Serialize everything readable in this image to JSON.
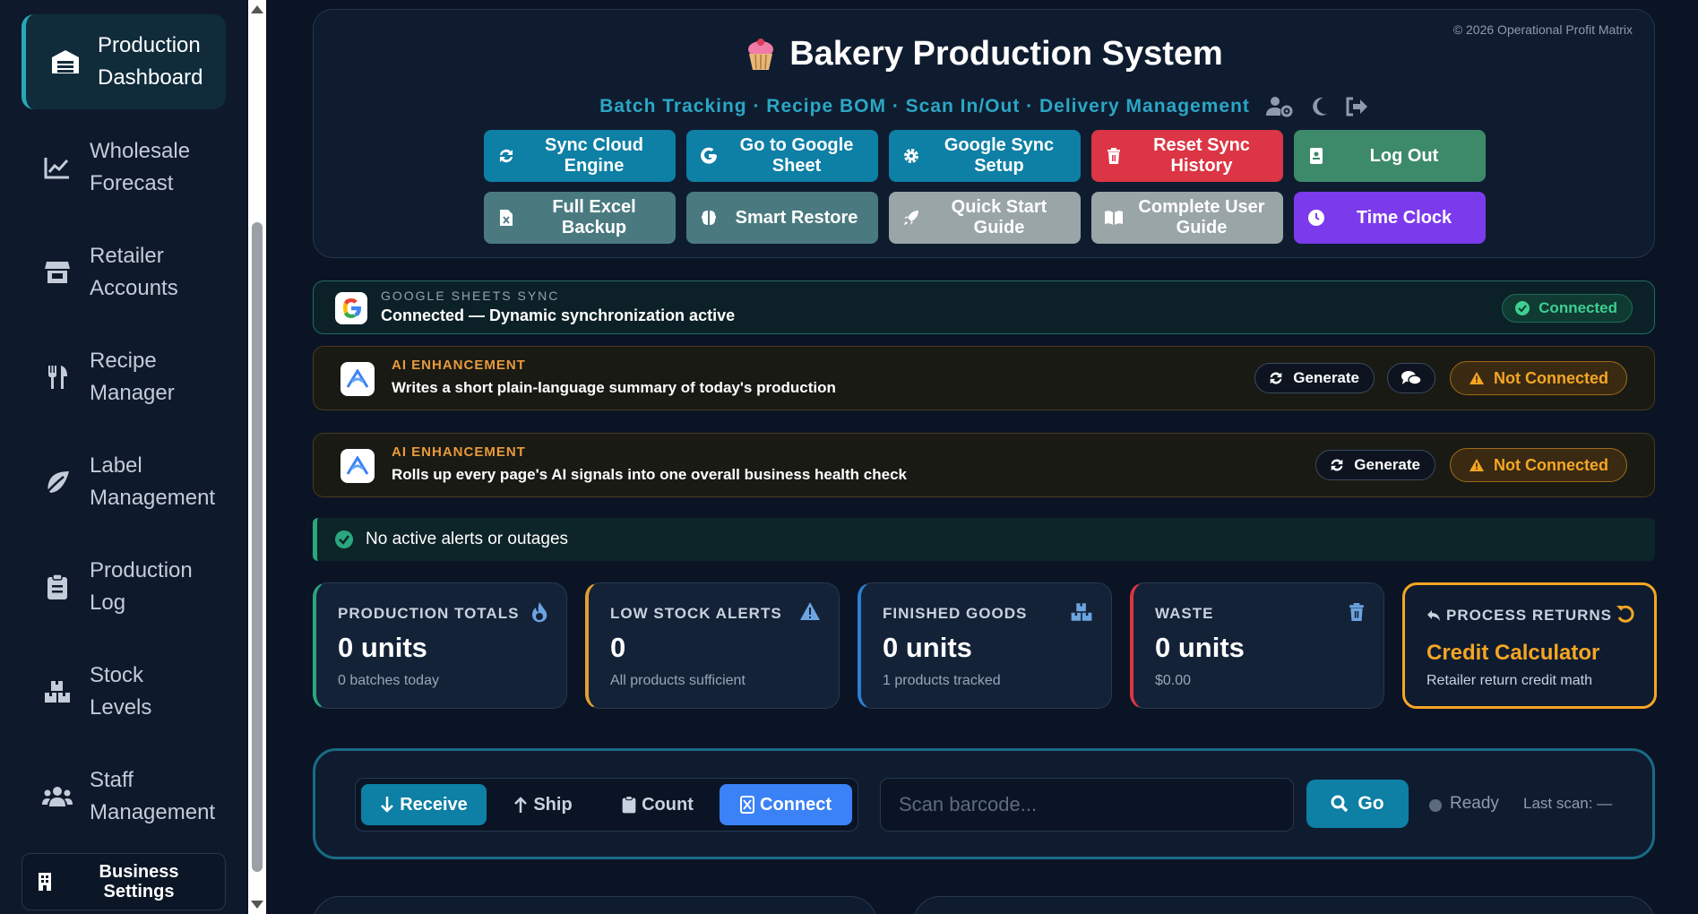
{
  "sidebar": {
    "items": [
      {
        "label_1": "Production",
        "label_2": "Dashboard",
        "icon": "warehouse-icon"
      },
      {
        "label_1": "Wholesale",
        "label_2": "Forecast",
        "icon": "line-chart-icon"
      },
      {
        "label_1": "Retailer",
        "label_2": "Accounts",
        "icon": "store-icon"
      },
      {
        "label_1": "Recipe",
        "label_2": "Manager",
        "icon": "utensils-icon"
      },
      {
        "label_1": "Label",
        "label_2": "Management",
        "icon": "leaf-icon"
      },
      {
        "label_1": "Production",
        "label_2": "Log",
        "icon": "clipboard-icon"
      },
      {
        "label_1": "Stock",
        "label_2": "Levels",
        "icon": "boxes-icon"
      },
      {
        "label_1": "Staff",
        "label_2": "Management",
        "icon": "users-icon"
      }
    ],
    "business_settings_1": "Business",
    "business_settings_2": "Settings"
  },
  "header": {
    "copyright": "© 2026 Operational Profit Matrix",
    "title": "Bakery Production System",
    "subtitle": "Batch Tracking · Recipe BOM · Scan In/Out · Delivery Management",
    "buttons": [
      {
        "label_1": "Sync Cloud",
        "label_2": "Engine",
        "color": "#0e7fa5",
        "icon": "sync-icon"
      },
      {
        "label_1": "Go to Google",
        "label_2": "Sheet",
        "color": "#0e7fa5",
        "icon": "google-icon"
      },
      {
        "label_1": "Google Sync",
        "label_2": "Setup",
        "color": "#0e7fa5",
        "icon": "gear-icon"
      },
      {
        "label_1": "Reset Sync",
        "label_2": "History",
        "color": "#dc3545",
        "icon": "trash-icon"
      },
      {
        "label_1": "Log Out",
        "label_2": "",
        "color": "#3d8a6a",
        "icon": "badge-icon"
      },
      {
        "label_1": "Full Excel",
        "label_2": "Backup",
        "color": "#4a7a80",
        "icon": "excel-file-icon"
      },
      {
        "label_1": "Smart Restore",
        "label_2": "",
        "color": "#4a7a80",
        "icon": "brain-icon"
      },
      {
        "label_1": "Quick Start",
        "label_2": "Guide",
        "color": "#9aa5a8",
        "icon": "rocket-icon"
      },
      {
        "label_1": "Complete User",
        "label_2": "Guide",
        "color": "#9aa5a8",
        "icon": "book-icon"
      },
      {
        "label_1": "Time Clock",
        "label_2": "",
        "color": "#7c3aed",
        "icon": "clock-icon"
      }
    ]
  },
  "sync": {
    "kicker": "GOOGLE SHEETS SYNC",
    "text": "Connected — Dynamic synchronization active",
    "status": "Connected"
  },
  "ai": [
    {
      "kicker": "AI ENHANCEMENT",
      "text": "Writes a short plain-language summary of today's production",
      "generate": "Generate",
      "status": "Not Connected"
    },
    {
      "kicker": "AI ENHANCEMENT",
      "text": "Rolls up every page's AI signals into one overall business health check",
      "generate": "Generate",
      "status": "Not Connected"
    }
  ],
  "alert": {
    "text": "No active alerts or outages"
  },
  "stats": [
    {
      "label": "PRODUCTION TOTALS",
      "value": "0 units",
      "sub": "0 batches today",
      "accent": "#2aa77c",
      "icon": "fire-icon"
    },
    {
      "label": "LOW STOCK ALERTS",
      "value": "0",
      "sub": "All products sufficient",
      "accent": "#e0a030",
      "icon": "warning-icon"
    },
    {
      "label": "FINISHED GOODS",
      "value": "0 units",
      "sub": "1 products tracked",
      "accent": "#2b7fd4",
      "icon": "boxes-icon"
    },
    {
      "label": "WASTE",
      "value": "0 units",
      "sub": "$0.00",
      "accent": "#dc3545",
      "icon": "trash-icon"
    },
    {
      "label": "PROCESS RETURNS",
      "value": "Credit Calculator",
      "sub": "Retailer return credit math",
      "accent": "#f5a623",
      "icon": "undo-icon"
    }
  ],
  "scanner": {
    "modes": [
      "Receive",
      "Ship",
      "Count",
      "Connect"
    ],
    "placeholder": "Scan barcode...",
    "go": "Go",
    "status": "Ready",
    "last_scan": "Last scan: —"
  }
}
